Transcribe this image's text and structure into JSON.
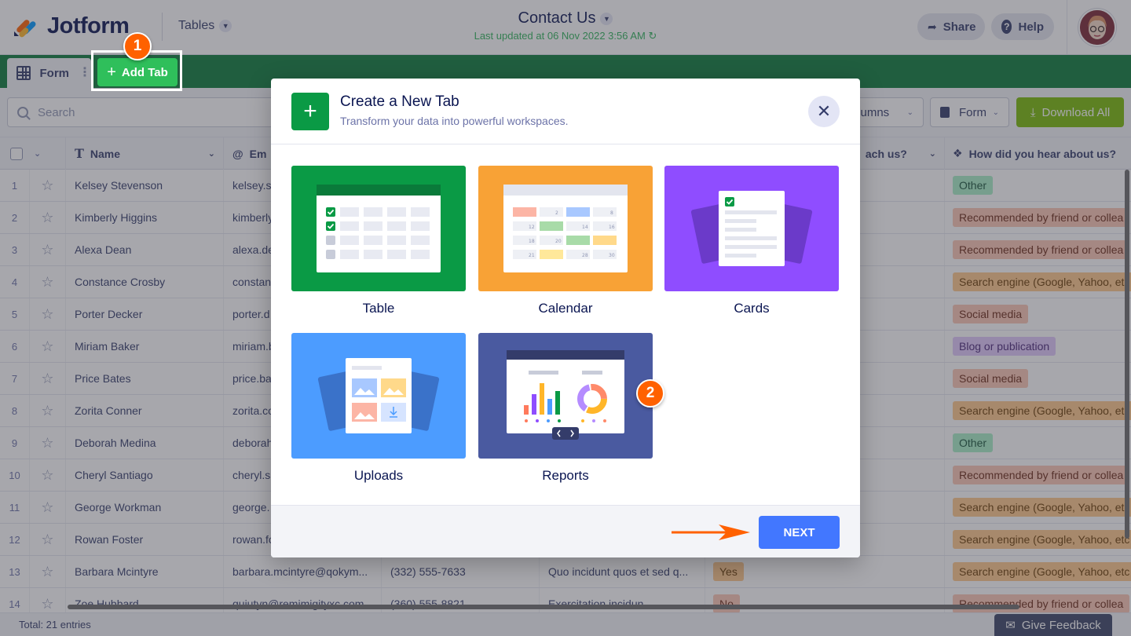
{
  "header": {
    "logo_text": "Jotform",
    "tables_menu": "Tables",
    "title": "Contact Us",
    "last_updated": "Last updated at 06 Nov 2022 3:56 AM",
    "share": "Share",
    "help": "Help"
  },
  "tabs": {
    "form_tab": "Form",
    "add_tab": "Add Tab"
  },
  "steps": {
    "one": "1",
    "two": "2"
  },
  "toolbar": {
    "search_placeholder": "Search",
    "columns": "Columns",
    "form_select": "Form",
    "download_all": "Download All"
  },
  "table": {
    "headers": {
      "name": "Name",
      "email": "Em",
      "reach": "ach us?",
      "hear": "How did you hear about us?"
    },
    "rows": [
      {
        "num": "1",
        "name": "Kelsey Stevenson",
        "email": "kelsey.s",
        "phone": "",
        "message": "",
        "reach": "",
        "hear": "Other",
        "hear_type": "other"
      },
      {
        "num": "2",
        "name": "Kimberly Higgins",
        "email": "kimberly",
        "phone": "",
        "message": "",
        "reach": "",
        "hear": "Recommended by friend or collea",
        "hear_type": "friend"
      },
      {
        "num": "3",
        "name": "Alexa Dean",
        "email": "alexa.de",
        "phone": "",
        "message": "",
        "reach": "",
        "hear": "Recommended by friend or collea",
        "hear_type": "friend"
      },
      {
        "num": "4",
        "name": "Constance Crosby",
        "email": "constan",
        "phone": "",
        "message": "",
        "reach": "",
        "hear": "Search engine (Google, Yahoo, etc",
        "hear_type": "search"
      },
      {
        "num": "5",
        "name": "Porter Decker",
        "email": "porter.d",
        "phone": "",
        "message": "",
        "reach": "",
        "hear": "Social media",
        "hear_type": "social"
      },
      {
        "num": "6",
        "name": "Miriam Baker",
        "email": "miriam.b",
        "phone": "",
        "message": "",
        "reach": "",
        "hear": "Blog or publication",
        "hear_type": "blog"
      },
      {
        "num": "7",
        "name": "Price Bates",
        "email": "price.ba",
        "phone": "",
        "message": "",
        "reach": "",
        "hear": "Social media",
        "hear_type": "social"
      },
      {
        "num": "8",
        "name": "Zorita Conner",
        "email": "zorita.co",
        "phone": "",
        "message": "",
        "reach": "",
        "hear": "Search engine (Google, Yahoo, etc",
        "hear_type": "search"
      },
      {
        "num": "9",
        "name": "Deborah Medina",
        "email": "deborah",
        "phone": "",
        "message": "",
        "reach": "",
        "hear": "Other",
        "hear_type": "other"
      },
      {
        "num": "10",
        "name": "Cheryl Santiago",
        "email": "cheryl.s",
        "phone": "",
        "message": "",
        "reach": "",
        "hear": "Recommended by friend or collea",
        "hear_type": "friend"
      },
      {
        "num": "11",
        "name": "George Workman",
        "email": "george.",
        "phone": "",
        "message": "",
        "reach": "",
        "hear": "Search engine (Google, Yahoo, etc",
        "hear_type": "search"
      },
      {
        "num": "12",
        "name": "Rowan Foster",
        "email": "rowan.fo",
        "phone": "",
        "message": "",
        "reach": "",
        "hear": "Search engine (Google, Yahoo, etc",
        "hear_type": "search"
      },
      {
        "num": "13",
        "name": "Barbara Mcintyre",
        "email": "barbara.mcintyre@qokym...",
        "phone": "(332) 555-7633",
        "message": "Quo incidunt quos et sed q...",
        "reach": "Yes",
        "reach_type": "yes",
        "hear": "Search engine (Google, Yahoo, etc",
        "hear_type": "search"
      },
      {
        "num": "14",
        "name": "Zoe Hubbard",
        "email": "quiutyn@remimigityxc.com",
        "phone": "(360) 555-8821",
        "message": "Exercitation incidun...",
        "reach": "No",
        "reach_type": "no",
        "hear": "Recommended by friend or collea",
        "hear_type": "friend"
      }
    ]
  },
  "footer": {
    "total": "Total: 21 entries",
    "feedback": "Give Feedback"
  },
  "modal": {
    "title": "Create a New Tab",
    "subtitle": "Transform your data into powerful workspaces.",
    "options": [
      {
        "label": "Table",
        "color": "#0a9a45"
      },
      {
        "label": "Calendar",
        "color": "#f8a236"
      },
      {
        "label": "Cards",
        "color": "#8f4dff"
      },
      {
        "label": "Uploads",
        "color": "#4c9cff"
      },
      {
        "label": "Reports",
        "color": "#4a5aa0"
      }
    ],
    "next": "NEXT"
  },
  "colors": {
    "brand_green": "#0a7a3a",
    "add_tab_green": "#2fbf5b",
    "download_green": "#78bb07",
    "next_blue": "#4277ff",
    "step_orange": "#ff6100"
  }
}
